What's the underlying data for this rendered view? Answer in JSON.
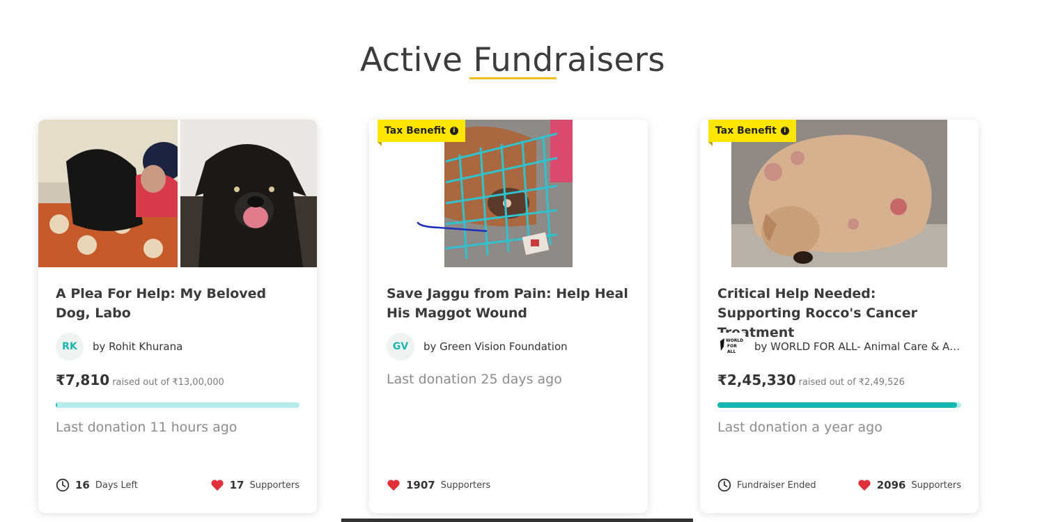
{
  "page": {
    "title": "Active Fundraisers"
  },
  "cards": [
    {
      "title": "A Plea For Help: My Beloved Dog, Labo",
      "tax_benefit": false,
      "organizer_initials": "RK",
      "organizer": "by Rohit Khurana",
      "amount": "₹7,810",
      "goal": "raised out of ₹13,00,000",
      "progress": 0.006,
      "last_donation": "Last donation 11 hours ago",
      "time_value": "16",
      "time_label": "Days Left",
      "supporters_value": "17",
      "supporters_label": "Supporters",
      "icons": [
        "clock-icon",
        "heart-icon"
      ]
    },
    {
      "title": "Save Jaggu from Pain: Help Heal His Maggot Wound",
      "tax_benefit": true,
      "tax_label": "Tax Benefit",
      "organizer_initials": "GV",
      "organizer": "by Green Vision Foundation",
      "last_donation": "Last donation 25 days ago",
      "supporters_value": "1907",
      "supporters_label": "Supporters",
      "icons": [
        "heart-icon",
        "info-icon"
      ]
    },
    {
      "title": "Critical Help Needed: Supporting Rocco's Cancer Treatment",
      "tax_benefit": true,
      "tax_label": "Tax Benefit",
      "organizer_logo_text": "WORLD FOR ALL",
      "organizer": "by WORLD FOR ALL- Animal Care & Ad…",
      "amount": "₹2,45,330",
      "goal": "raised out of ₹2,49,526",
      "progress": 0.983,
      "last_donation": "Last donation a year ago",
      "time_label": "Fundraiser Ended",
      "supporters_value": "2096",
      "supporters_label": "Supporters",
      "icons": [
        "clock-icon",
        "heart-icon",
        "info-icon"
      ]
    }
  ],
  "colors": {
    "accent_underline": "#f2be1a",
    "progress_fill": "#16b7b2",
    "progress_track": "#b5ece9",
    "tax_badge": "#ffe600",
    "heart": "#e0303a"
  }
}
